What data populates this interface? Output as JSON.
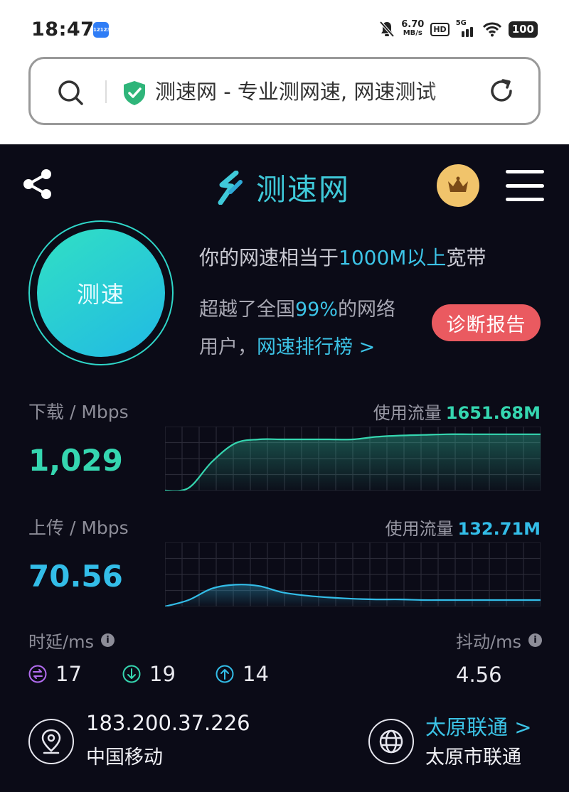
{
  "status_bar": {
    "time": "18:47",
    "app_icon_text": "12123",
    "net_speed_value": "6.70",
    "net_speed_unit": "MB/s",
    "hd_badge": "HD",
    "network_type": "5G",
    "battery": "100"
  },
  "browser": {
    "url_title": "测速网 - 专业测网速, 网速测试"
  },
  "header": {
    "logo_text": "测速网"
  },
  "result": {
    "test_button_label": "测速",
    "equivalent_prefix": "你的网速相当于",
    "equivalent_value": "1000M以上",
    "equivalent_suffix": "宽带",
    "beat_prefix": "超越了全国",
    "beat_percent": "99%",
    "beat_suffix": "的网络",
    "users_prefix": "用户，",
    "ranking_link": "网速排行榜 >",
    "diagnose_button": "诊断报告"
  },
  "download": {
    "label": "下载 / Mbps",
    "value": "1,029",
    "usage_label": "使用流量",
    "usage_value": "1651.68M",
    "color": "#35d6b0"
  },
  "upload": {
    "label": "上传 / Mbps",
    "value": "70.56",
    "usage_label": "使用流量",
    "usage_value": "132.71M",
    "color": "#33bde8"
  },
  "latency": {
    "label": "时延/ms",
    "info_icon": "i",
    "idle": "17",
    "download": "19",
    "upload": "14",
    "idle_color": "#b26cf0",
    "download_color": "#35d6b0",
    "upload_color": "#33bde8"
  },
  "jitter": {
    "label": "抖动/ms",
    "info_icon": "i",
    "value": "4.56"
  },
  "connection": {
    "ip": "183.200.37.226",
    "isp": "中国移动",
    "node_link": "太原联通 >",
    "node_name": "太原市联通"
  },
  "icons": {
    "search": "search-icon",
    "shield": "shield-check-icon",
    "reload": "reload-icon",
    "share": "share-icon",
    "logo": "speed-logo-icon",
    "vip": "crown-icon",
    "menu": "hamburger-menu-icon",
    "location": "location-pin-icon",
    "globe": "globe-icon"
  },
  "chart_data": [
    {
      "type": "area",
      "series": [
        {
          "name": "下载",
          "values": [
            0,
            4,
            45,
            74,
            80,
            80,
            80,
            80,
            80,
            84,
            86,
            87,
            88,
            88,
            88,
            88,
            88
          ]
        }
      ],
      "x": [
        0,
        1,
        2,
        3,
        4,
        5,
        6,
        7,
        8,
        9,
        10,
        11,
        12,
        13,
        14,
        15,
        16
      ],
      "ylim": [
        0,
        100
      ],
      "grid": true
    },
    {
      "type": "area",
      "series": [
        {
          "name": "上传",
          "values": [
            0,
            10,
            28,
            34,
            32,
            22,
            17,
            14,
            12,
            11,
            11,
            10,
            10,
            10,
            10,
            10,
            10
          ]
        }
      ],
      "x": [
        0,
        1,
        2,
        3,
        4,
        5,
        6,
        7,
        8,
        9,
        10,
        11,
        12,
        13,
        14,
        15,
        16
      ],
      "ylim": [
        0,
        100
      ],
      "grid": true
    }
  ]
}
